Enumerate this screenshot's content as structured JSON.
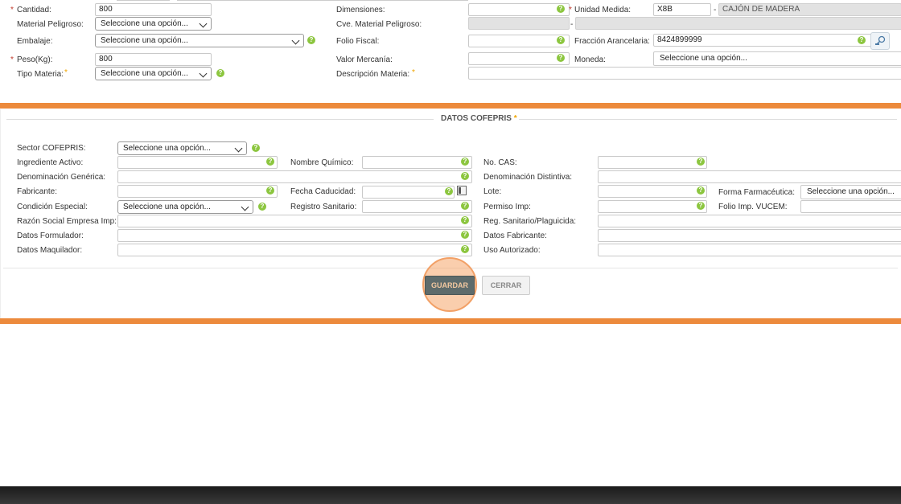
{
  "top_form": {
    "cantidad_label": "Cantidad:",
    "cantidad_value": "800",
    "material_peligroso_label": "Material Peligroso:",
    "material_peligroso_value": "Seleccione una opción...",
    "embalaje_label": "Embalaje:",
    "embalaje_value": "Seleccione una opción...",
    "peso_label": "Peso(Kg):",
    "peso_value": "800",
    "tipo_materia_label": "Tipo Materia:",
    "tipo_materia_value": "Seleccione una opción...",
    "dimensiones_label": "Dimensiones:",
    "cve_material_label": "Cve. Material Peligroso:",
    "folio_fiscal_label": "Folio Fiscal:",
    "valor_mercancia_label": "Valor Mercanía:",
    "descripcion_materia_label": "Descripción Materia:",
    "unidad_medida_label": "Unidad Medida:",
    "unidad_medida_code": "X8B",
    "unidad_medida_desc": "CAJÓN DE MADERA",
    "fraccion_label": "Fracción Arancelaria:",
    "fraccion_value": "8424899999",
    "moneda_label": "Moneda:",
    "moneda_value": "Seleccione una opción...",
    "dash": "-",
    "required_mark": "*"
  },
  "cofepris": {
    "title": "DATOS COFEPRIS",
    "sector_label": "Sector COFEPRIS:",
    "sector_value": "Seleccione una opción...",
    "ingrediente_label": "Ingrediente Activo:",
    "denominacion_generica_label": "Denominación Genérica:",
    "fabricante_label": "Fabricante:",
    "condicion_label": "Condición Especial:",
    "condicion_value": "Seleccione una opción...",
    "razon_social_label": "Razón Social Empresa Imp:",
    "datos_formulador_label": "Datos Formulador:",
    "datos_maquilador_label": "Datos Maquilador:",
    "nombre_quimico_label": "Nombre Químico:",
    "fecha_caducidad_label": "Fecha Caducidad:",
    "registro_sanitario_label": "Registro Sanitario:",
    "no_cas_label": "No. CAS:",
    "denominacion_distintiva_label": "Denominación Distintiva:",
    "lote_label": "Lote:",
    "permiso_imp_label": "Permiso Imp:",
    "reg_sanitario_label": "Reg. Sanitario/Plaguicida:",
    "datos_fabricante_label": "Datos Fabricante:",
    "uso_autorizado_label": "Uso Autorizado:",
    "forma_farmaceutica_label": "Forma Farmacéutica:",
    "forma_farmaceutica_value": "Seleccione una opción...",
    "folio_imp_label": "Folio Imp. VUCEM:"
  },
  "buttons": {
    "guardar": "GUARDAR",
    "cerrar": "CERRAR"
  },
  "colors": {
    "accent_orange": "#ec8a3c",
    "help_green": "#8cc63f",
    "guardar_bg": "#5e6b6b"
  },
  "help_glyph": "?"
}
